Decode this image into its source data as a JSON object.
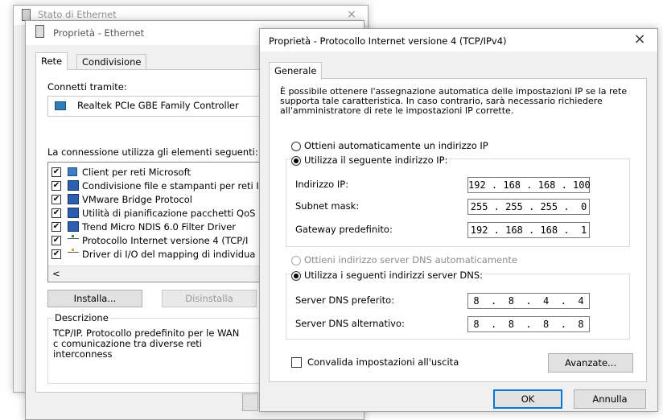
{
  "back_window": {
    "title": "Stato di Ethernet",
    "close": "×"
  },
  "eth_window": {
    "title": "Proprietà - Ethernet",
    "tabs": [
      "Rete",
      "Condivisione"
    ],
    "connect_label": "Connetti tramite:",
    "adapter": "Realtek PCIe GBE Family Controller",
    "items_label": "La connessione utilizza gli elementi seguenti:",
    "items": [
      {
        "label": "Client per reti Microsoft",
        "checked": true,
        "icon": "network-client-icon"
      },
      {
        "label": "Condivisione file e stampanti per reti I",
        "checked": true,
        "icon": "service-icon"
      },
      {
        "label": "VMware Bridge Protocol",
        "checked": true,
        "icon": "protocol-icon"
      },
      {
        "label": "Utilità di pianificazione pacchetti QoS",
        "checked": true,
        "icon": "service-icon"
      },
      {
        "label": "Trend Micro NDIS 6.0 Filter Driver",
        "checked": true,
        "icon": "service-icon"
      },
      {
        "label": "Protocollo Internet versione 4 (TCP/I",
        "checked": true,
        "icon": "tcp-icon"
      },
      {
        "label": "Driver di I/O del mapping di individua",
        "checked": true,
        "icon": "tcp-icon"
      }
    ],
    "install_button": "Installa...",
    "uninstall_button": "Disinstalla",
    "description_label": "Descrizione",
    "description_text": "TCP/IP. Protocollo predefinito per le WAN c comunicazione tra diverse reti interconness",
    "scroll_left": "<"
  },
  "ipv4_window": {
    "title": "Proprietà - Protocollo Internet versione 4 (TCP/IPv4)",
    "close": "×",
    "tab": "Generale",
    "intro": "È possibile ottenere l'assegnazione automatica delle impostazioni IP se la rete supporta tale caratteristica. In caso contrario, sarà necessario richiedere all'amministratore di rete le impostazioni IP corrette.",
    "auto_ip_label": "Ottieni automaticamente un indirizzo IP",
    "manual_ip_label": "Utilizza il seguente indirizzo IP:",
    "ip_label": "Indirizzo IP:",
    "ip_value": "192 . 168 . 168 . 100",
    "mask_label": "Subnet mask:",
    "mask_value": "255 . 255 . 255 .  0",
    "gateway_label": "Gateway predefinito:",
    "gateway_value": "192 . 168 . 168 .  1",
    "auto_dns_label": "Ottieni indirizzo server DNS automaticamente",
    "manual_dns_label": "Utilizza i seguenti indirizzi server DNS:",
    "dns1_label": "Server DNS preferito:",
    "dns1_value": "8  .  8  .  4  .  4",
    "dns2_label": "Server DNS alternativo:",
    "dns2_value": "8  .  8  .  8  .  8",
    "validate_label": "Convalida impostazioni all'uscita",
    "advanced_button": "Avanzate...",
    "ok_button": "OK",
    "cancel_button": "Annulla",
    "selected": {
      "ip": "manual",
      "dns": "manual",
      "validate": false
    }
  },
  "colors": {
    "accent": "#0078d7",
    "window_bg": "#f0f0f0",
    "panel_bg": "#ffffff"
  }
}
